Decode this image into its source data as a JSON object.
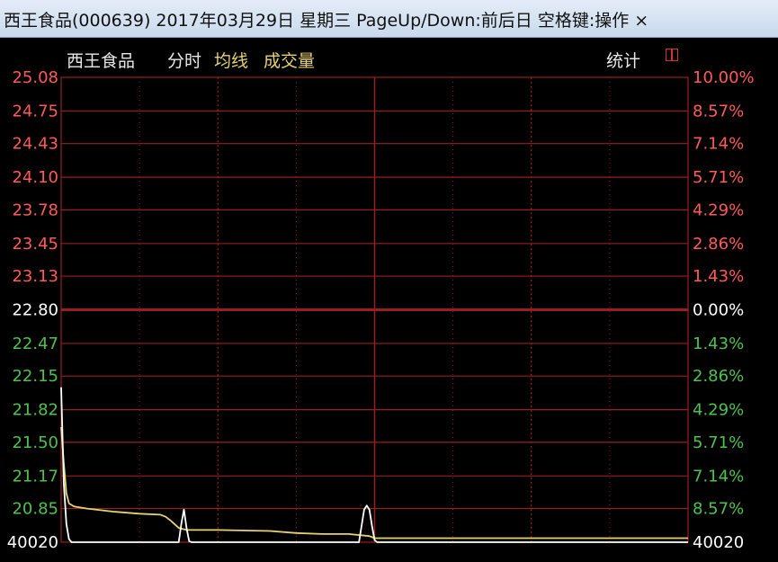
{
  "window": {
    "title": "西王食品(000639) 2017年03月29日 星期三 PageUp/Down:前后日 空格键:操作 ×"
  },
  "toolbar": {
    "stock_name": "西王食品",
    "tab_timeshare": "分时",
    "tab_avg_line": "均线",
    "tab_volume": "成交量",
    "stats_label": "统计"
  },
  "colors": {
    "background": "#000000",
    "grid": "#9a1e1e",
    "up": "#ff5a5a",
    "down": "#4ec24e",
    "neutral": "#ffffff",
    "price_line": "#ffffff",
    "avg_line": "#e6d270",
    "tab_text": "#e6d270"
  },
  "chart_data": {
    "type": "line",
    "title": "",
    "prev_close": 22.8,
    "ylim": [
      20.52,
      25.08
    ],
    "left_ticks": [
      "25.08",
      "24.75",
      "24.43",
      "24.10",
      "23.78",
      "23.45",
      "23.13",
      "22.80",
      "22.47",
      "22.15",
      "21.82",
      "21.50",
      "21.17",
      "20.85",
      "40020"
    ],
    "left_tick_values": [
      25.08,
      24.75,
      24.43,
      24.1,
      23.78,
      23.45,
      23.13,
      22.8,
      22.47,
      22.15,
      21.82,
      21.5,
      21.17,
      20.85,
      20.52
    ],
    "right_ticks": [
      "10.00%",
      "8.57%",
      "7.14%",
      "5.71%",
      "4.29%",
      "2.86%",
      "1.43%",
      "0.00%",
      "1.43%",
      "2.86%",
      "4.29%",
      "5.71%",
      "7.14%",
      "8.57%",
      "40020"
    ],
    "time_slots": 241,
    "series": [
      {
        "role": "price",
        "color": "#ffffff",
        "points": [
          [
            0,
            22.04
          ],
          [
            1,
            21.1
          ],
          [
            2,
            20.7
          ],
          [
            3,
            20.55
          ],
          [
            4,
            20.52
          ],
          [
            20,
            20.52
          ],
          [
            40,
            20.52
          ],
          [
            45,
            20.52
          ],
          [
            46,
            20.7
          ],
          [
            47,
            20.84
          ],
          [
            48,
            20.66
          ],
          [
            49,
            20.53
          ],
          [
            50,
            20.52
          ],
          [
            80,
            20.52
          ],
          [
            100,
            20.52
          ],
          [
            110,
            20.52
          ],
          [
            114,
            20.52
          ],
          [
            115,
            20.68
          ],
          [
            116,
            20.84
          ],
          [
            117,
            20.88
          ],
          [
            118,
            20.84
          ],
          [
            119,
            20.68
          ],
          [
            120,
            20.54
          ],
          [
            121,
            20.52
          ],
          [
            160,
            20.52
          ],
          [
            200,
            20.52
          ],
          [
            240,
            20.52
          ]
        ]
      },
      {
        "role": "average",
        "color": "#e6d270",
        "points": [
          [
            0,
            21.65
          ],
          [
            1,
            21.3
          ],
          [
            2,
            21.0
          ],
          [
            3,
            20.9
          ],
          [
            5,
            20.87
          ],
          [
            10,
            20.85
          ],
          [
            20,
            20.82
          ],
          [
            30,
            20.8
          ],
          [
            38,
            20.79
          ],
          [
            40,
            20.77
          ],
          [
            42,
            20.73
          ],
          [
            45,
            20.66
          ],
          [
            48,
            20.64
          ],
          [
            60,
            20.64
          ],
          [
            80,
            20.63
          ],
          [
            90,
            20.61
          ],
          [
            100,
            20.6
          ],
          [
            110,
            20.6
          ],
          [
            118,
            20.58
          ],
          [
            120,
            20.56
          ],
          [
            125,
            20.56
          ],
          [
            160,
            20.56
          ],
          [
            200,
            20.56
          ],
          [
            240,
            20.56
          ]
        ]
      }
    ]
  }
}
